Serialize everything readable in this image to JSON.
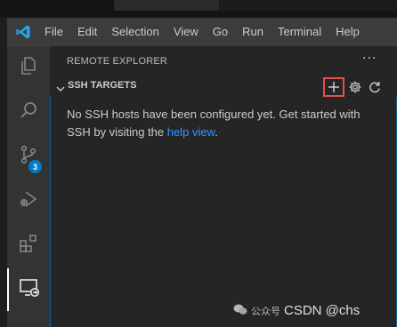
{
  "menu": [
    "File",
    "Edit",
    "Selection",
    "View",
    "Go",
    "Run",
    "Terminal",
    "Help"
  ],
  "activity": {
    "items": [
      {
        "name": "explorer-icon"
      },
      {
        "name": "search-icon"
      },
      {
        "name": "source-control-icon"
      },
      {
        "name": "run-debug-icon"
      },
      {
        "name": "extensions-icon"
      },
      {
        "name": "remote-explorer-icon"
      }
    ],
    "source_control_badge": "3"
  },
  "sidebar": {
    "header": "REMOTE EXPLORER",
    "more": "···",
    "section_title": "SSH TARGETS",
    "message_prefix": "No SSH hosts have been configured yet. Get started with SSH by visiting the ",
    "message_link": "help view",
    "message_suffix": "."
  },
  "watermark": {
    "left": "公众号",
    "right": "CSDN @chs"
  },
  "colors": {
    "accent": "#007acc",
    "link": "#3794ff",
    "highlight_box": "#e0524a"
  }
}
